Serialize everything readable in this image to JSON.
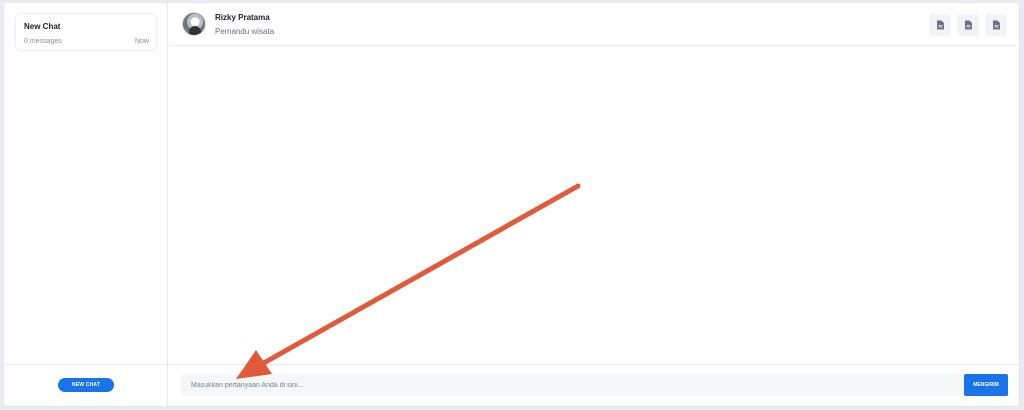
{
  "sidebar": {
    "chats": [
      {
        "title": "New Chat",
        "count": "0 messages",
        "time": "Now"
      }
    ],
    "new_chat_label": "NEW CHAT"
  },
  "header": {
    "name": "Rizky Pratama",
    "role": "Pemandu wisata",
    "icons": [
      "document-icon",
      "document-icon",
      "document-icon"
    ]
  },
  "input": {
    "placeholder": "Masukkan pertanyaan Anda di sini...",
    "value": "",
    "send_label": "MENGIRIM"
  },
  "annotation": {
    "arrow_color": "#e05a3c"
  },
  "colors": {
    "accent": "#1a73e8"
  }
}
